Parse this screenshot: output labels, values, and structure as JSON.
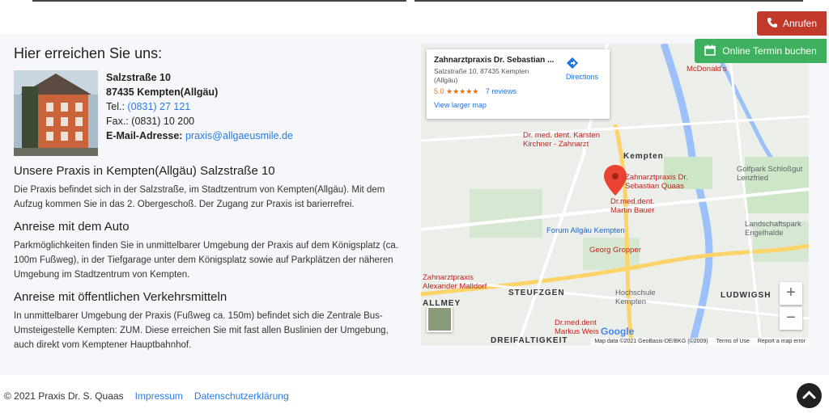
{
  "header_buttons": {
    "call_label": "Anrufen",
    "book_label": "Online Termin buchen"
  },
  "contact": {
    "title": "Hier erreichen Sie uns:",
    "street": "Salzstraße 10",
    "city": "87435 Kempten(Allgäu)",
    "tel_label": "Tel.:",
    "tel_value": "(0831) 27 121",
    "fax_label": "Fax.:",
    "fax_value": "(0831) 10 200",
    "email_label": "E-Mail-Adresse:",
    "email_value": "praxis@allgaeusmile.de"
  },
  "sections": [
    {
      "heading": "Unsere Praxis in Kempten(Allgäu) Salzstraße 10",
      "text": "Die Praxis befindet sich in der Salzstraße, im Stadtzentrum von Kempten(Allgäu). Mit dem Aufzug kommen Sie in das 2. Obergeschoß. Der Zugang zur Praxis ist barierrefrei."
    },
    {
      "heading": "Anreise mit dem Auto",
      "text": "Parkmöglichkeiten finden Sie in unmittelbarer Umgebung der Praxis auf dem Königsplatz (ca. 100m Fußweg), in der Tiefgarage unter dem Königsplatz sowie auf Parkplätzen der näheren Umgebung im Stadtzentrum von Kempten."
    },
    {
      "heading": "Anreise mit öffentlichen Verkehrsmitteln",
      "text": "In unmittelbarer Umgebung der Praxis (Fußweg ca. 150m) befindet sich die Zentrale Bus-Umsteigestelle Kempten: ZUM. Diese erreichen Sie mit fast allen Buslinien der Umgebung, auch direkt vom Kemptener Hauptbahnhof."
    }
  ],
  "map": {
    "card_title": "Zahnarztpraxis Dr. Sebastian ...",
    "card_address": "Salzstraße 10, 87435 Kempten (Allgäu)",
    "rating": "5.0 ★★★★★",
    "reviews": "7 reviews",
    "larger_map": "View larger map",
    "directions": "Directions",
    "labels": {
      "kempten": "Kempten",
      "quaas": "Zahnarztpraxis Dr. Sebastian Quaas",
      "bauer": "Dr.med.dent. Martin Bauer",
      "kirchner": "Dr. med. dent. Karsten Kirchner - Zahnarzt",
      "forum": "Forum Allgäu Kempten",
      "gropper": "Georg Gropper",
      "malldorf": "Zahnarztpraxis Alexander Malldorf",
      "steufzgen": "STEUFZGEN",
      "hochschule": "Hochschule Kempten",
      "ludwigsh": "LUDWIGSH",
      "weis": "Dr.med.dent Markus Weis",
      "dreifalt": "DREIFALTIGKEIT",
      "golfpark": "Golfpark Schloßgut Lenzfried",
      "landschaft": "Landschaftspark Engelhalde",
      "mcdonalds": "McDonald's",
      "allmey": "ALLMEY"
    },
    "attribution": "Map data ©2021 GeoBasis-DE/BKG (©2009)",
    "terms": "Terms of Use",
    "report": "Report a map error",
    "google": "Google",
    "zoom_in": "+",
    "zoom_out": "−"
  },
  "footer": {
    "copyright": "© 2021 Praxis Dr. S. Quaas",
    "impressum": "Impressum",
    "datenschutz": "Datenschutzerklärung"
  },
  "colors": {
    "call_button": "#c0392b",
    "book_button": "#3fb060",
    "link": "#2a7ae2"
  }
}
